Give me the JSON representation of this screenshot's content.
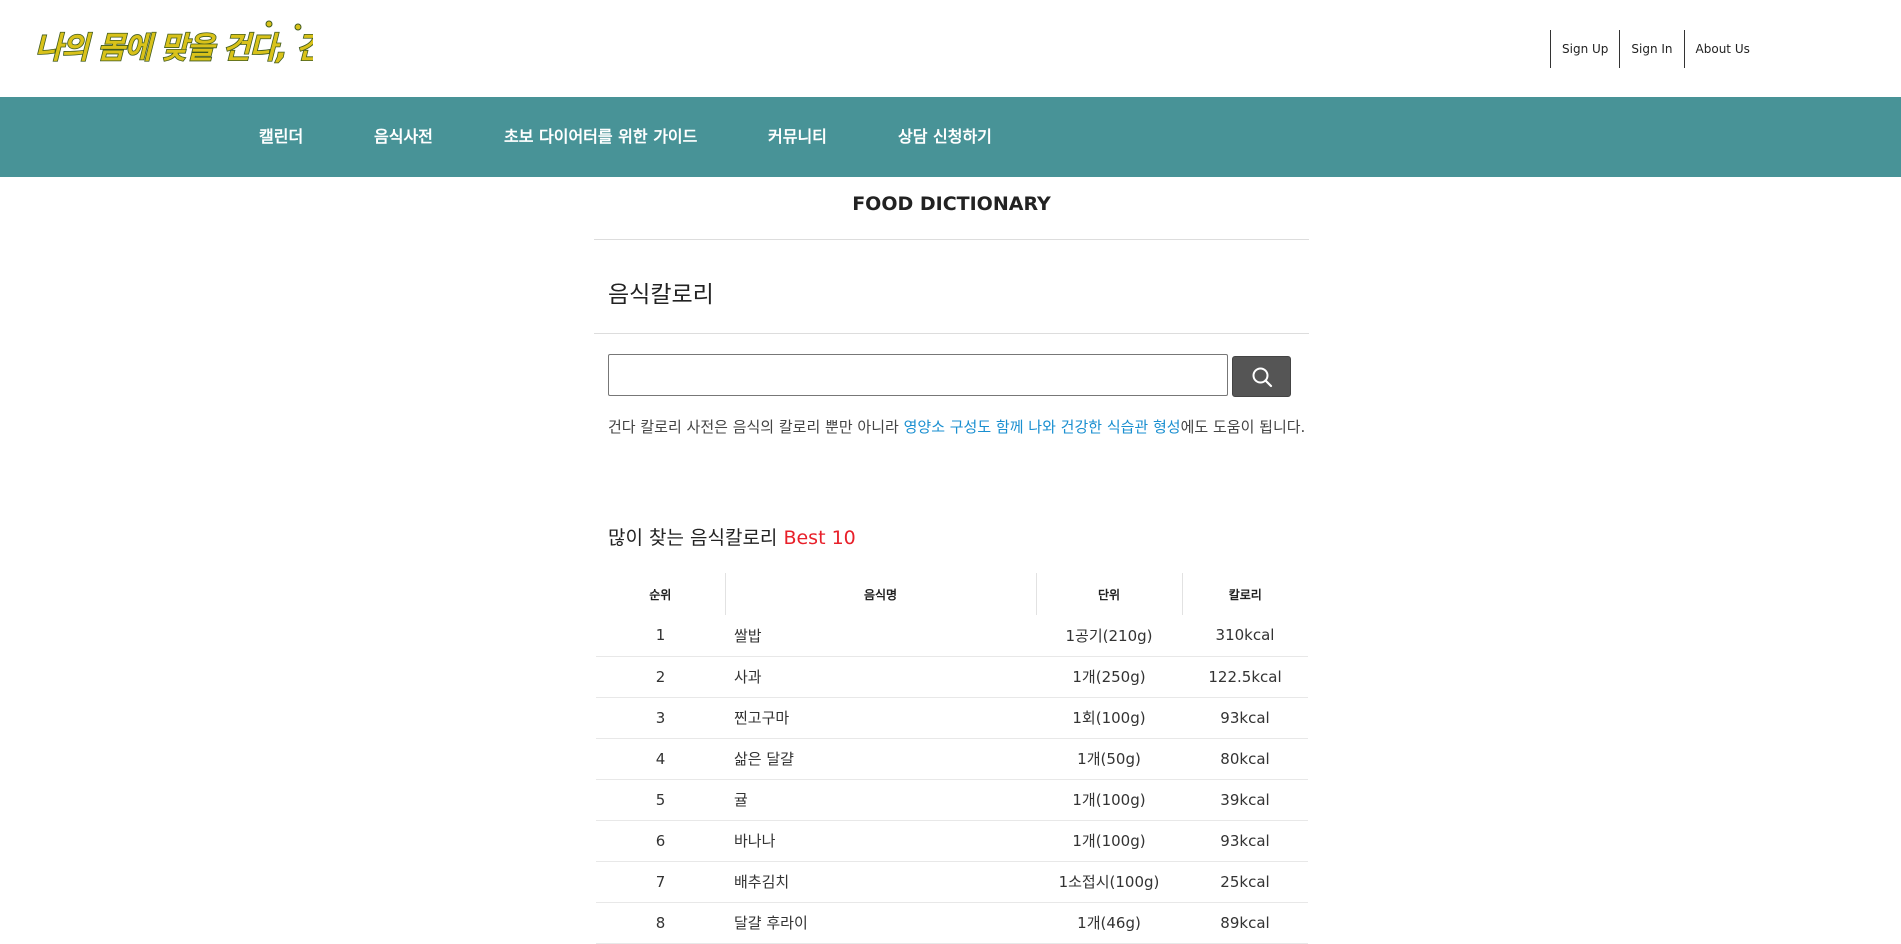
{
  "header": {
    "logo_text": "나의 몸에 맞을 건다, 건다",
    "links": [
      "Sign Up",
      "Sign In",
      "About Us"
    ]
  },
  "nav": {
    "items": [
      "캘린더",
      "음식사전",
      "초보 다이어터를 위한 가이드",
      "커뮤니티",
      "상담 신청하기"
    ]
  },
  "main": {
    "heading": "FOOD DICTIONARY",
    "section_title": "음식칼로리",
    "search": {
      "value": "",
      "placeholder": "",
      "button_icon": "search-icon"
    },
    "description": {
      "prefix": "건다 칼로리 사전은 음식의 칼로리 뿐만 아니라 ",
      "highlight": "영양소 구성도 함께 나와 건강한 식습관 형성",
      "suffix": "에도 도움이 됩니다."
    },
    "best": {
      "title": "많이 찾는 음식칼로리 ",
      "title_accent": "Best 10",
      "columns": [
        "순위",
        "음식명",
        "단위",
        "칼로리"
      ],
      "rows": [
        {
          "rank": "1",
          "name": "쌀밥",
          "unit": "1공기(210g)",
          "kcal": "310kcal"
        },
        {
          "rank": "2",
          "name": "사과",
          "unit": "1개(250g)",
          "kcal": "122.5kcal"
        },
        {
          "rank": "3",
          "name": "찐고구마",
          "unit": "1회(100g)",
          "kcal": "93kcal"
        },
        {
          "rank": "4",
          "name": "삶은 달걀",
          "unit": "1개(50g)",
          "kcal": "80kcal"
        },
        {
          "rank": "5",
          "name": "귤",
          "unit": "1개(100g)",
          "kcal": "39kcal"
        },
        {
          "rank": "6",
          "name": "바나나",
          "unit": "1개(100g)",
          "kcal": "93kcal"
        },
        {
          "rank": "7",
          "name": "배추김치",
          "unit": "1소접시(100g)",
          "kcal": "25kcal"
        },
        {
          "rank": "8",
          "name": "달걀 후라이",
          "unit": "1개(46g)",
          "kcal": "89kcal"
        }
      ]
    }
  },
  "colors": {
    "nav_bg": "#489397",
    "link_highlight": "#1a8fd0",
    "accent_red": "#e8202a",
    "logo_fill": "#d9c21a",
    "logo_outline": "#3f5a1f",
    "search_button_bg": "#555555"
  }
}
